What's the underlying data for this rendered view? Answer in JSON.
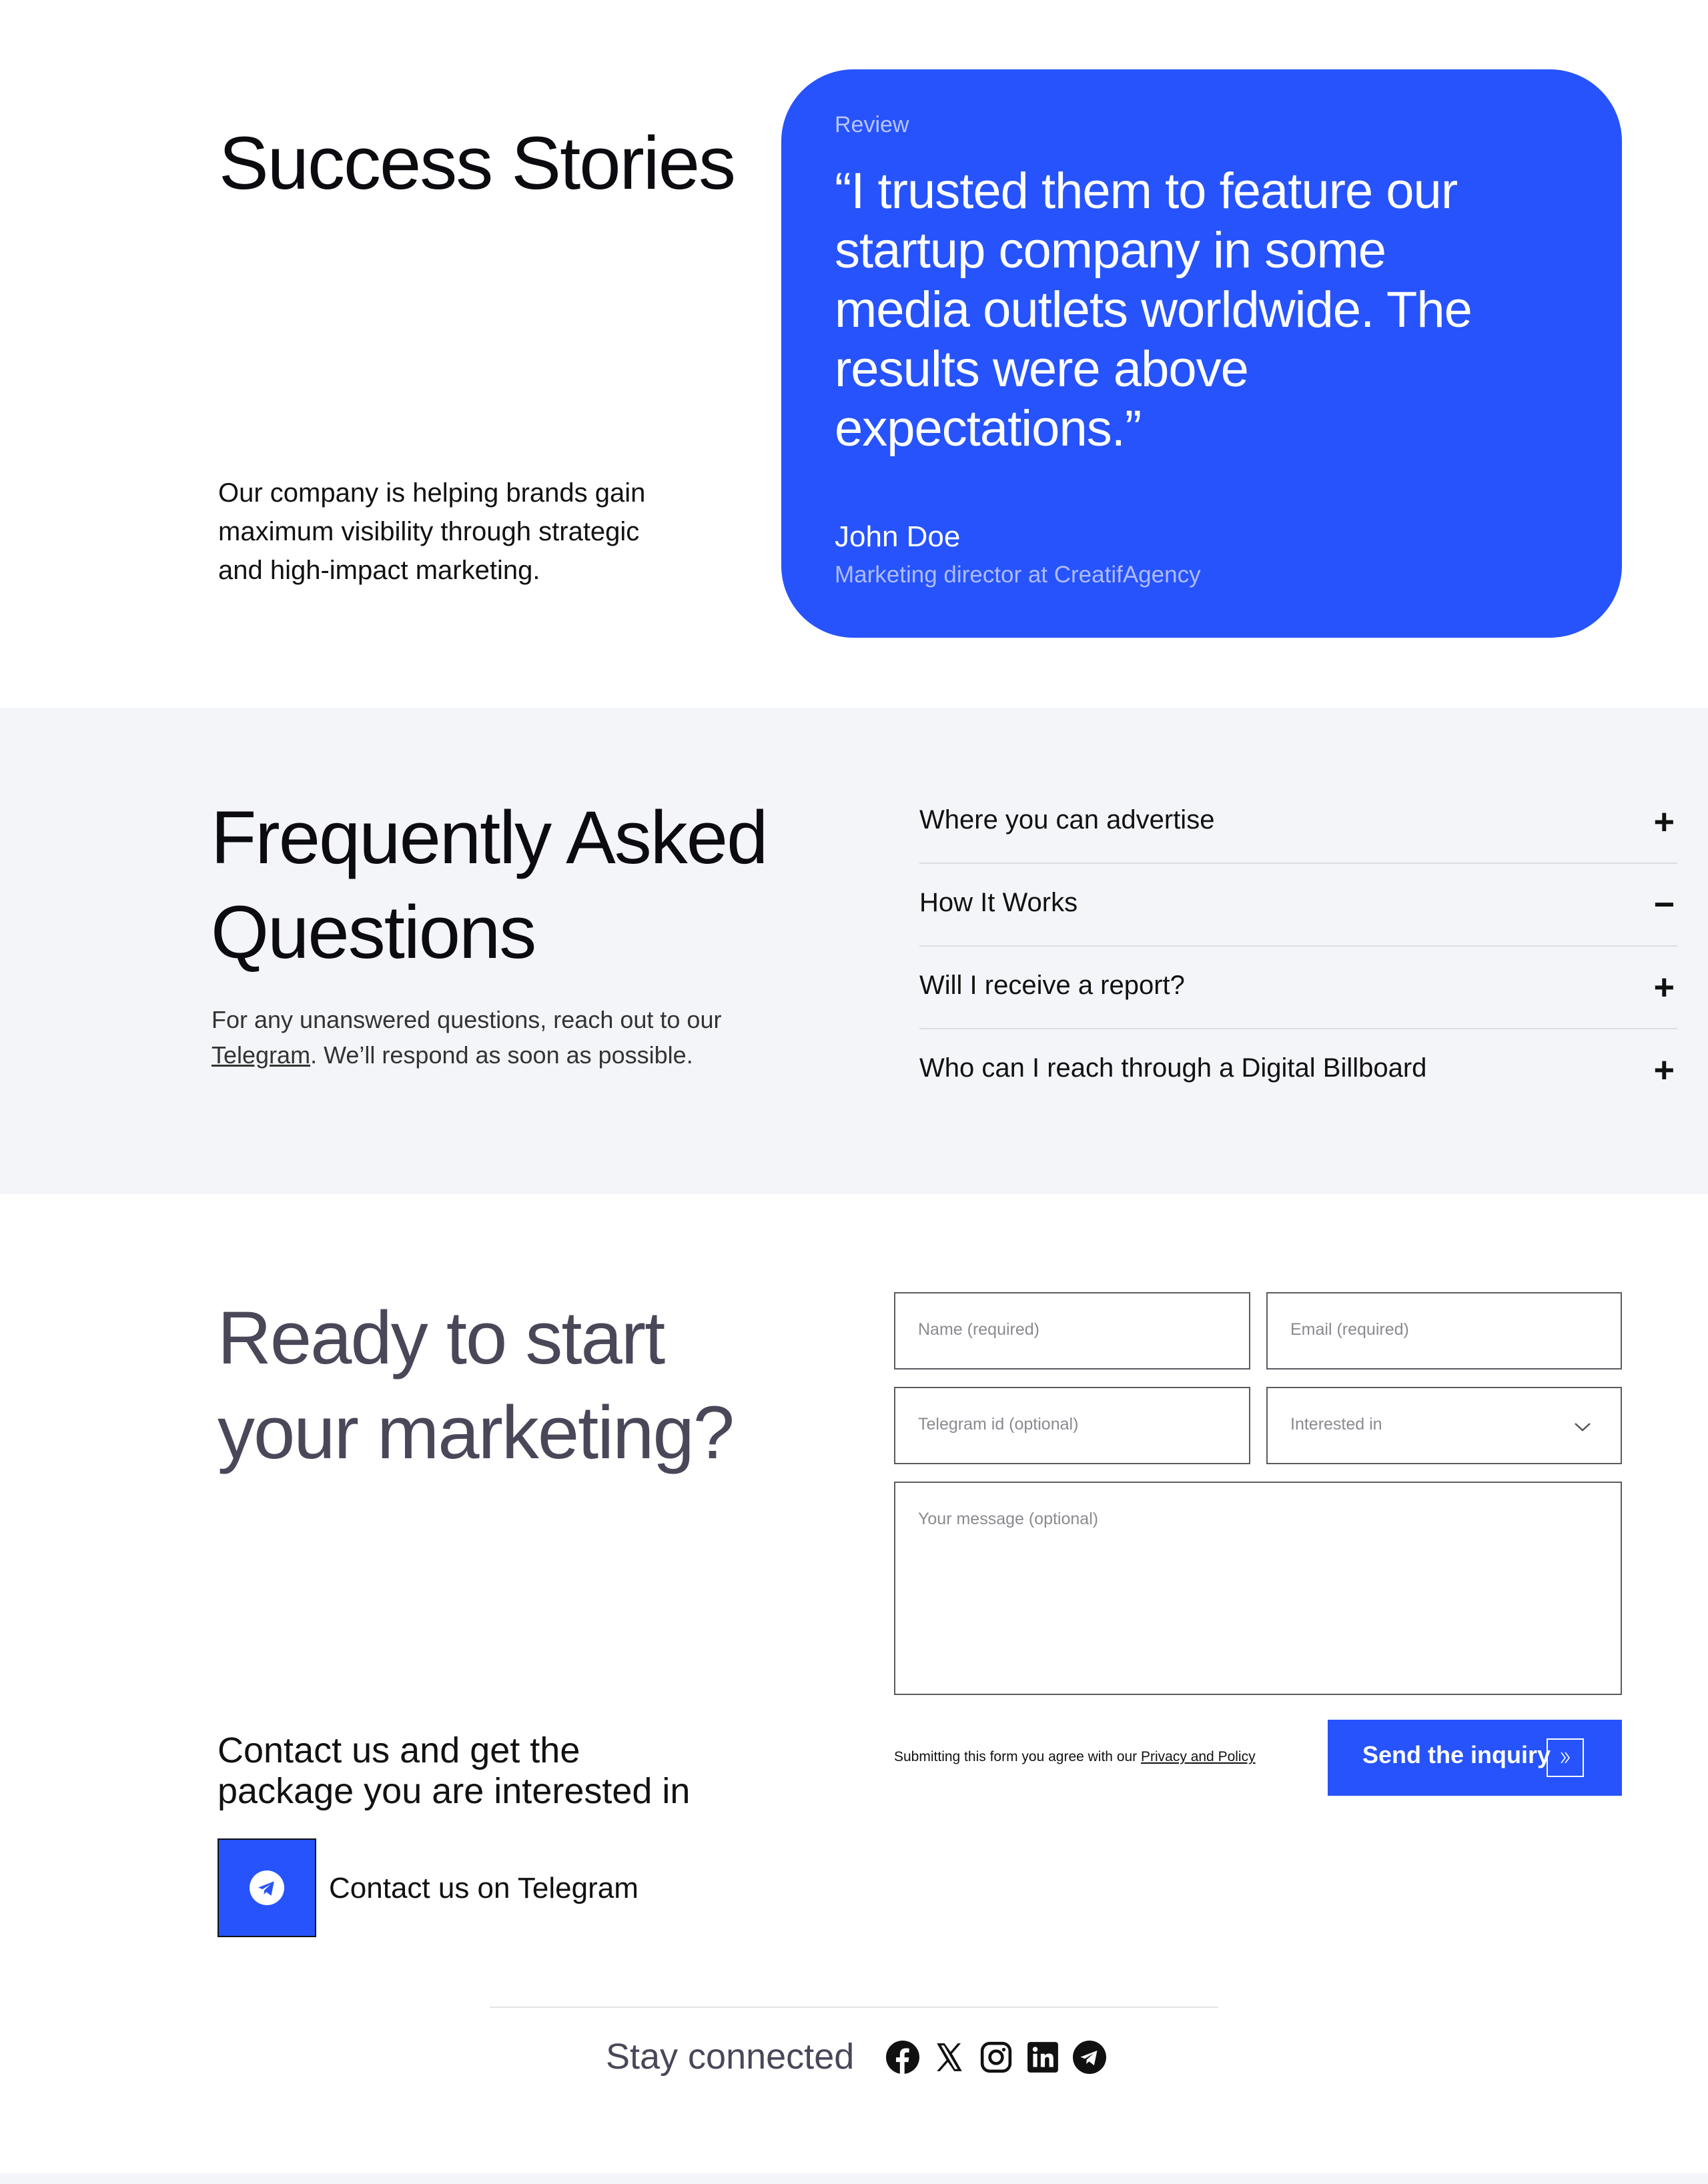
{
  "success": {
    "title": "Success Stories",
    "description": [
      "Our company is helping brands gain",
      "maximum visibility through strategic",
      "and high-impact marketing."
    ],
    "review": {
      "label": "Review",
      "quote_lines": [
        "“I trusted them to feature our",
        "startup company in some",
        "media outlets worldwide. The",
        "results were above",
        "expectations.”"
      ],
      "author": "John Doe",
      "role": "Marketing director at CreatifAgency"
    }
  },
  "faq": {
    "title_lines": [
      "Frequently Asked",
      "Questions"
    ],
    "text_before": "For any unanswered questions, reach out to our",
    "link": "Telegram",
    "text_after": ". We’ll respond as soon as possible.",
    "items": [
      {
        "question": "Where you can advertise",
        "icon": "+"
      },
      {
        "question": "How It Works",
        "icon": "−"
      },
      {
        "question": "Will I receive a report?",
        "icon": "+"
      },
      {
        "question": "Who can I reach through a Digital Billboard",
        "icon": "+"
      }
    ]
  },
  "contact": {
    "title_lines": [
      "Ready to start",
      "your marketing?"
    ],
    "subtitle_lines": [
      "Contact us and get the",
      "package you are interested in"
    ],
    "telegram_label": "Contact us on Telegram",
    "form": {
      "name_placeholder": "Name (required)",
      "email_placeholder": "Email (required)",
      "telegram_placeholder": "Telegram id (optional)",
      "interest_placeholder": "Interested in",
      "message_placeholder": "Your message (optional)",
      "disclaimer": "Submitting this form you agree with our",
      "policy_link": "Privacy and Policy",
      "submit_label": "Send the inquiry"
    }
  },
  "footer": {
    "stay_connected": "Stay connected",
    "social_icons": [
      "facebook-icon",
      "x-icon",
      "instagram-icon",
      "linkedin-icon",
      "telegram-icon"
    ]
  },
  "colors": {
    "accent": "#2653fc",
    "faq_bg": "#f4f5f8",
    "heading_muted": "#4a4759"
  }
}
